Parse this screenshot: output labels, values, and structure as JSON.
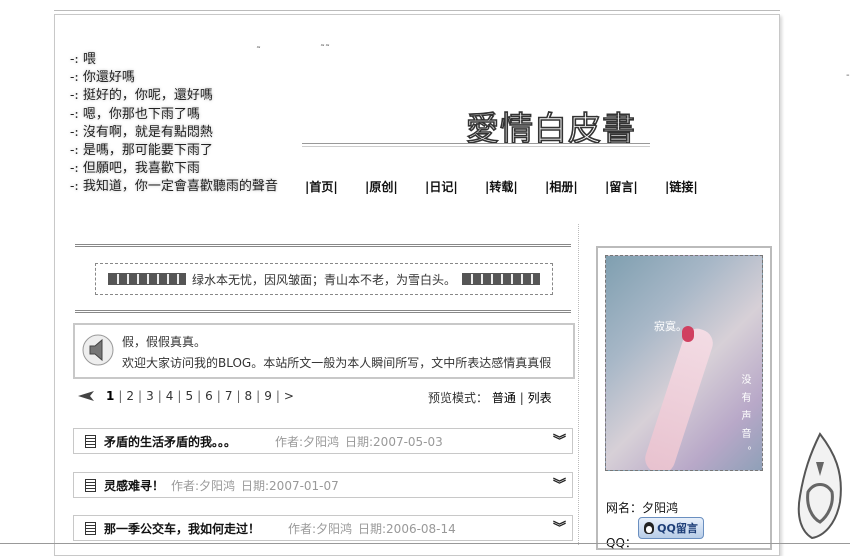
{
  "poem": [
    "-: 喂",
    "-: 你還好嗎",
    "-: 挺好的，你呢，還好嗎",
    "-: 嗯，你那也下雨了嗎",
    "-: 沒有啊，就是有點悶熱",
    "-: 是嗎，那可能要下雨了",
    "-: 但願吧，我喜歡下雨",
    "-: 我知道，你一定會喜歡聽雨的聲音"
  ],
  "site_title": "愛情白皮書",
  "nav": [
    "|首页|",
    "|原创|",
    "|日记|",
    "|转载|",
    "|相册|",
    "|留言|",
    "|链接|"
  ],
  "motto": "绿水本无忧，因风皱面；青山本不老，为雪白头。",
  "notice": {
    "line1": "假，假假真真。",
    "line2": "欢迎大家访问我的BLOG。本站所文一般为本人瞬间所写，文中所表达感情真真假"
  },
  "pager": {
    "pages": [
      "1",
      "2",
      "3",
      "4",
      "5",
      "6",
      "7",
      "8",
      "9"
    ],
    "next": ">",
    "current": "1"
  },
  "preview": {
    "label": "预览模式：",
    "normal": "普通",
    "sep": "|",
    "list": "列表"
  },
  "posts": [
    {
      "title": "矛盾的生活矛盾的我。。。",
      "author": "作者:夕阳鸿",
      "date": "日期:2007-05-03"
    },
    {
      "title": "灵感难寻！",
      "author": "作者:夕阳鸿",
      "date": "日期:2007-01-07"
    },
    {
      "title": "那一季公交车，我如何走过！",
      "author": "作者:夕阳鸿",
      "date": "日期:2006-08-14"
    }
  ],
  "sidebar": {
    "photo_text_1": "寂寞。",
    "photo_text_2": "没有声音。",
    "netname": "网名：夕阳鸿",
    "qq_button": "QQ留言",
    "qq_label": "QQ："
  },
  "icons": {
    "speaker": "speaker-icon",
    "doc": "document-icon",
    "expand": "double-chevron-down-icon",
    "back": "back-arrow-icon",
    "qq": "qq-penguin-icon"
  }
}
